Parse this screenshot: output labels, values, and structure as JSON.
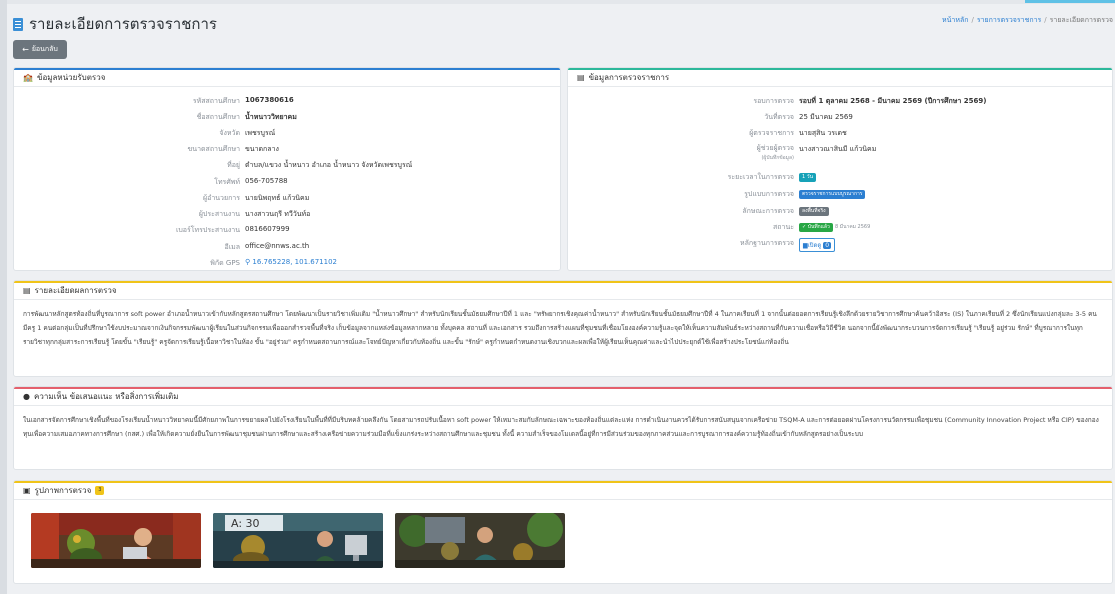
{
  "page": {
    "title": "รายละเอียดการตรวจราชการ",
    "back_label": "ย้อนกลับ",
    "breadcrumb": [
      "หน้าหลัก",
      "รายการตรวจราชการ",
      "รายละเอียดการตรวจ"
    ]
  },
  "unit_card": {
    "title": "ข้อมูลหน่วยรับตรวจ",
    "rows": [
      {
        "label": "รหัสสถานศึกษา",
        "value": "1067380616"
      },
      {
        "label": "ชื่อสถานศึกษา",
        "value": "น้ำหนาววิทยาคม"
      },
      {
        "label": "จังหวัด",
        "value": "เพชรบูรณ์"
      },
      {
        "label": "ขนาดสถานศึกษา",
        "value": "ขนาดกลาง"
      },
      {
        "label": "ที่อยู่",
        "value": "ตำบล/แขวง น้ำหนาว อำเภอ น้ำหนาว จังหวัดเพชรบูรณ์"
      },
      {
        "label": "โทรศัพท์",
        "value": "056-705788"
      },
      {
        "label": "ผู้อำนวยการ",
        "value": "นายนิพฤทธ์ แก้วนิคม"
      },
      {
        "label": "ผู้ประสานงาน",
        "value": "นางสาวนฤรี ทวีวันท์อ"
      },
      {
        "label": "เบอร์โทรประสานงาน",
        "value": "0816607999"
      },
      {
        "label": "อีเมล",
        "value": "office@nnws.ac.th"
      },
      {
        "label": "พิกัด GPS",
        "value": "16.765228, 101.671102"
      }
    ]
  },
  "inspect_card": {
    "title": "ข้อมูลการตรวจราชการ",
    "round_label": "รอบการตรวจ",
    "round_value": "รอบที่ 1 ตุลาคม 2568 - มีนาคม 2569 (ปีการศึกษา 2569)",
    "date_label": "วันที่ตรวจ",
    "date_value": "25 มีนาคม 2569",
    "inspector_label": "ผู้ตรวจราชการ",
    "inspector_value": "นายสุสิน วรเดช",
    "assistant_label": "ผู้ช่วยผู้ตรวจ",
    "assistant_sublabel": "(ผู้บันทึกข้อมูล)",
    "assistant_value": "นางสาวณาสินมี แก้วนิคม",
    "duration_label": "ระยะเวลาในการตรวจ",
    "duration_badge": "1 วัน",
    "format_label": "รูปแบบการตรวจ",
    "format_badge": "ตรวจราชการแบบบูรณาการ",
    "type_label": "ลักษณะการตรวจ",
    "type_badge": "ลงพื้นที่จริง",
    "status_label": "สถานะ",
    "status_badge": "บันทึกแล้ว",
    "status_date": "8 มีนาคม 2569",
    "evidence_label": "หลักฐานการตรวจ",
    "evidence_button": "เปิดดู",
    "evidence_count": "0"
  },
  "result_card": {
    "title": "รายละเอียดผลการตรวจ",
    "text": "การพัฒนาหลักสูตรท้องถิ่นที่บูรณาการ soft power อำเภอน้ำหนาวเข้ากับหลักสูตรสถานศึกษา โดยพัฒนาเป็นรายวิชาเพิ่มเติม \"น้ำหนาวศึกษา\" สำหรับนักเรียนชั้นมัธยมศึกษาปีที่ 1 และ \"ทรัพยากรเชิงคุณค่าน้ำหนาว\" สำหรับนักเรียนชั้นมัธยมศึกษาปีที่ 4 ในภาคเรียนที่ 1 จากนั้นต่อยอดการเรียนรู้เชิงลึกด้วยรายวิชาการศึกษาค้นคว้าอิสระ (IS) ในภาคเรียนที่ 2 ซึ่งนักเรียนแบ่งกลุ่มละ 3-5 คน มีครู 1 คนต่อกลุ่มเป็นที่ปรึกษาใช้งบประมาณจากเงินกิจกรรมพัฒนาผู้เรียนในส่วนกิจกรรมเพื่อออกสำรวจพื้นที่จริง เก็บข้อมูลจากแหล่งข้อมูลหลากหลาย ทั้งบุคคล สถานที่ และเอกสาร รวมถึงการสร้างแผนที่ชุมชนที่เชื่อมโยงองค์ความรู้และจุดให้เห็นความสัมพันธ์ระหว่างสถานที่กับความเชื่อหรือวิถีชีวิต นอกจากนี้ยังพัฒนากระบวนการจัดการเรียนรู้ \"เรียนรู้ อยู่ร่วม รักษ์\" ที่บูรณาการในทุกรายวิชาทุกกลุ่มสาระการเรียนรู้ โดยขั้น \"เรียนรู้\" ครูจัดการเรียนรู้เนื้อหาวิชาในห้อง ขั้น \"อยู่ร่วม\" ครูกำหนดสถานการณ์และโจทย์ปัญหาเกี่ยวกับท้องถิ่น และขั้น \"รักษ์\" ครูกำหนดกำหนดงานเชิงบวกและผลเพื่อให้ผู้เรียนเห็นคุณค่าและนำไปประยุกต์ใช้เพื่อสร้างประโยชน์แก่ท้องถิ่น"
  },
  "opinion_card": {
    "title": "ความเห็น ข้อเสนอแนะ หรือสิ่งการเพิ่มเติม",
    "text": "ในเอกสารจัดการศึกษาเชิงพื้นที่ของโรงเรียนน้ำหนาววิทยาคมนี้มีศักยภาพในการขยายผลไปยังโรงเรียนในพื้นที่ที่มีบริบทคล้ายคลึงกัน โดยสามารถปรับเนื้อหา soft power ให้เหมาะสมกับลักษณะเฉพาะของท้องถิ่นแต่ละแห่ง การดำเนินงานควรได้รับการสนับสนุนจากเครือข่าย TSQM-A และการต่อยอดผ่านโครงการนวัตกรรมเพื่อชุมชน (Community Innovation Project หรือ CIP) ของกองทุนเพื่อความเสมอภาคทางการศึกษา (กสศ.) เพื่อให้เกิดความยั่งยืนในการพัฒนาชุมชนผ่านการศึกษาและสร้างเครือข่ายความร่วมมือที่แข็งแกร่งระหว่างสถานศึกษาและชุมชน ทั้งนี้ ความสำเร็จของโมเดลนี้อยู่ที่การมีส่วนร่วมของทุกภาคส่วนและการบูรณาการองค์ความรู้ท้องถิ่นเข้ากับหลักสูตรอย่างเป็นระบบ"
  },
  "photo_card": {
    "title": "รูปภาพการตรวจ",
    "count": "3",
    "photo3_sign": "A: 30"
  },
  "colors": {
    "primary": "#2c7fd1",
    "info": "#17a2b8",
    "success": "#28a745",
    "secondary": "#6c757d",
    "warning": "#f0c419",
    "danger": "#e4606d"
  }
}
